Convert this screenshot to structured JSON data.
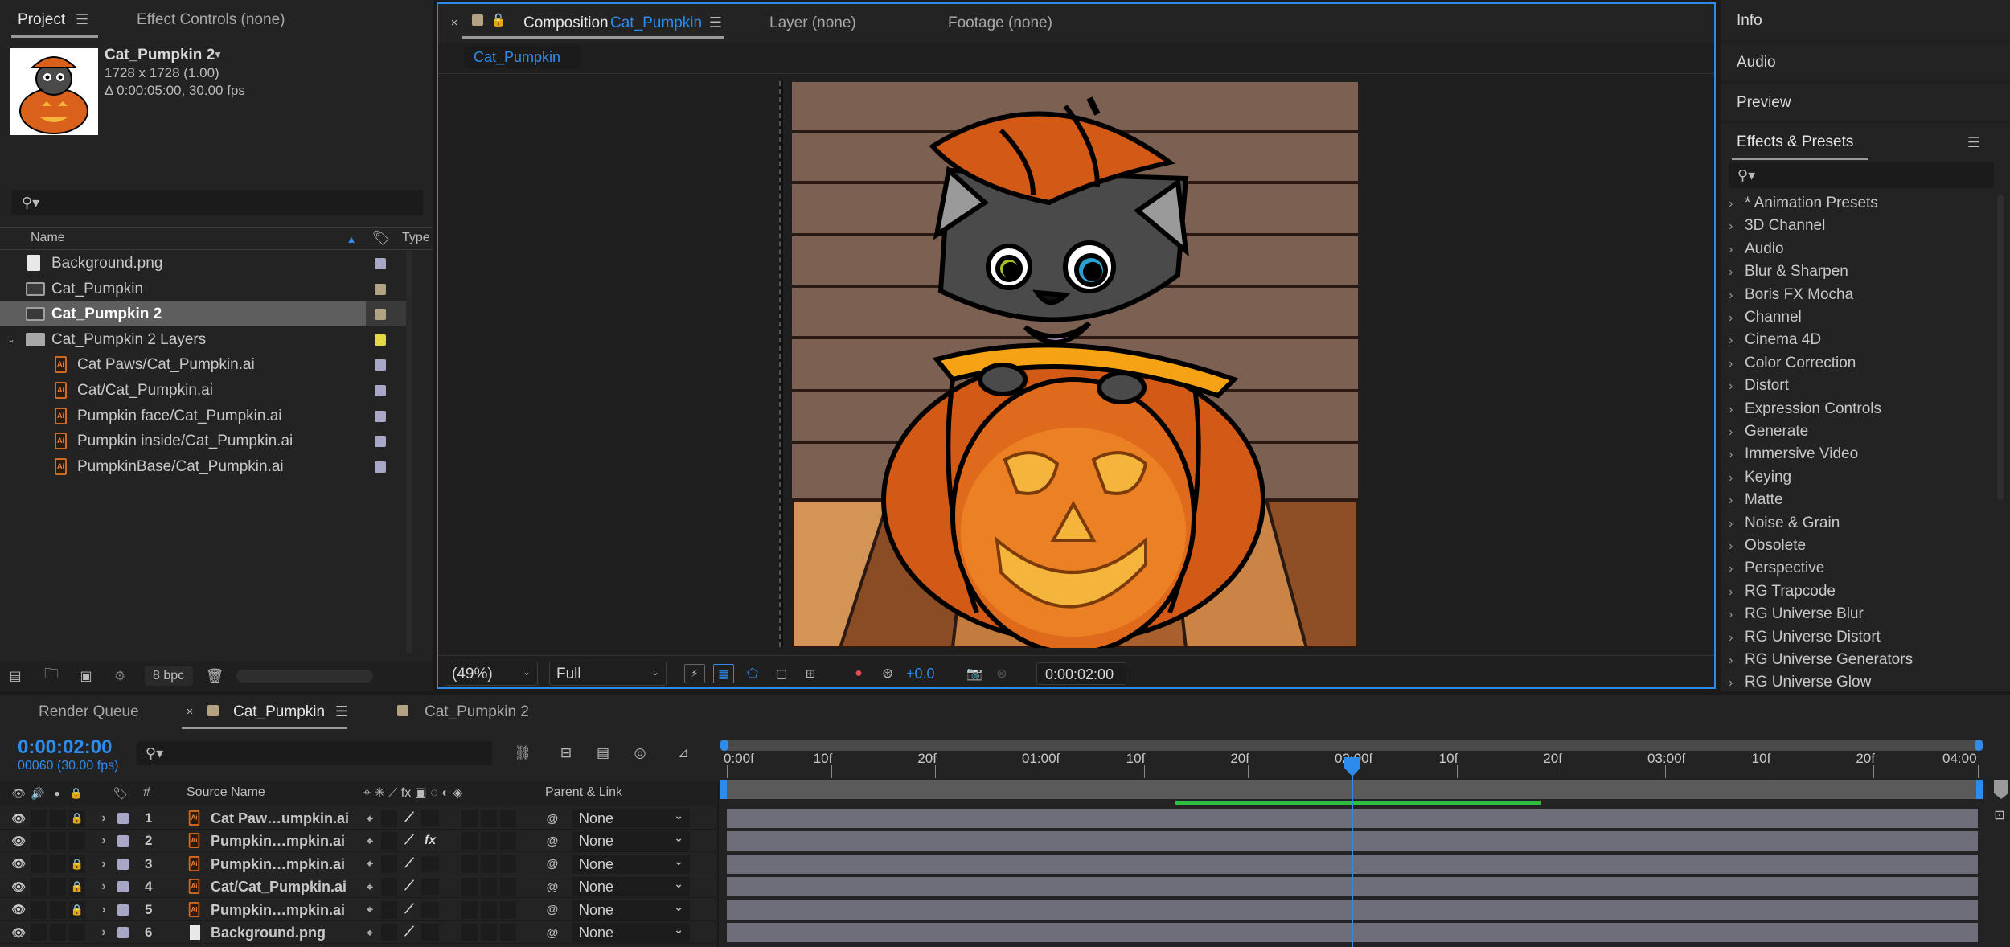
{
  "project_panel": {
    "tab_project": "Project",
    "tab_effect_controls": "Effect Controls (none)",
    "item_name": "Cat_Pumpkin 2",
    "item_dims": "1728 x 1728 (1.00)",
    "item_duration": "Δ 0:00:05:00, 30.00 fps",
    "col_name": "Name",
    "col_type": "Type",
    "bpc": "8 bpc",
    "items": [
      {
        "name": "Background.png",
        "kind": "png",
        "label_color": "#a9a7c8"
      },
      {
        "name": "Cat_Pumpkin",
        "kind": "comp",
        "label_color": "#b4a382"
      },
      {
        "name": "Cat_Pumpkin 2",
        "kind": "comp",
        "label_color": "#b4a382"
      },
      {
        "name": "Cat_Pumpkin 2 Layers",
        "kind": "folder",
        "label_color": "#e4d845"
      },
      {
        "name": "Cat Paws/Cat_Pumpkin.ai",
        "kind": "ai",
        "label_color": "#a9a7c8"
      },
      {
        "name": "Cat/Cat_Pumpkin.ai",
        "kind": "ai",
        "label_color": "#a9a7c8"
      },
      {
        "name": "Pumpkin face/Cat_Pumpkin.ai",
        "kind": "ai",
        "label_color": "#a9a7c8"
      },
      {
        "name": "Pumpkin inside/Cat_Pumpkin.ai",
        "kind": "ai",
        "label_color": "#a9a7c8"
      },
      {
        "name": "PumpkinBase/Cat_Pumpkin.ai",
        "kind": "ai",
        "label_color": "#a9a7c8"
      }
    ]
  },
  "comp_panel": {
    "tab_composition": "Composition",
    "comp_name": "Cat_Pumpkin",
    "tab_layer": "Layer (none)",
    "tab_footage": "Footage (none)",
    "breadcrumb": "Cat_Pumpkin",
    "zoom": "(49%)",
    "resolution": "Full",
    "exposure": "+0.0",
    "timecode": "0:00:02:00"
  },
  "right_panel": {
    "info": "Info",
    "audio": "Audio",
    "preview": "Preview",
    "effects_title": "Effects & Presets",
    "effects": [
      "* Animation Presets",
      "3D Channel",
      "Audio",
      "Blur & Sharpen",
      "Boris FX Mocha",
      "Channel",
      "Cinema 4D",
      "Color Correction",
      "Distort",
      "Expression Controls",
      "Generate",
      "Immersive Video",
      "Keying",
      "Matte",
      "Noise & Grain",
      "Obsolete",
      "Perspective",
      "RG Trapcode",
      "RG Universe Blur",
      "RG Universe Distort",
      "RG Universe Generators",
      "RG Universe Glow"
    ]
  },
  "timeline": {
    "tab_render_queue": "Render Queue",
    "tab_active": "Cat_Pumpkin",
    "tab_other": "Cat_Pumpkin 2",
    "current_time": "0:00:02:00",
    "frame_info": "00060 (30.00 fps)",
    "col_num": "#",
    "col_source": "Source Name",
    "col_parent": "Parent & Link",
    "ruler": [
      "0:00f",
      "10f",
      "20f",
      "01:00f",
      "10f",
      "20f",
      "02:00f",
      "10f",
      "20f",
      "03:00f",
      "10f",
      "20f",
      "04:00"
    ],
    "playhead_fraction": 0.5,
    "layers": [
      {
        "num": "1",
        "name": "Cat Paw…umpkin.ai",
        "kind": "ai",
        "locked": true,
        "fx": false,
        "parent": "None"
      },
      {
        "num": "2",
        "name": "Pumpkin…mpkin.ai",
        "kind": "ai",
        "locked": false,
        "fx": true,
        "parent": "None"
      },
      {
        "num": "3",
        "name": "Pumpkin…mpkin.ai",
        "kind": "ai",
        "locked": true,
        "fx": false,
        "parent": "None"
      },
      {
        "num": "4",
        "name": "Cat/Cat_Pumpkin.ai",
        "kind": "ai",
        "locked": true,
        "fx": false,
        "parent": "None"
      },
      {
        "num": "5",
        "name": "Pumpkin…mpkin.ai",
        "kind": "ai",
        "locked": true,
        "fx": false,
        "parent": "None"
      },
      {
        "num": "6",
        "name": "Background.png",
        "kind": "png",
        "locked": false,
        "fx": false,
        "parent": "None"
      }
    ]
  },
  "colors": {
    "accent_blue": "#2d8ceb",
    "work_area_green": "#2ebd3f",
    "layer_bar": "#6e6e7a",
    "label_lavender": "#a9a7c8"
  }
}
